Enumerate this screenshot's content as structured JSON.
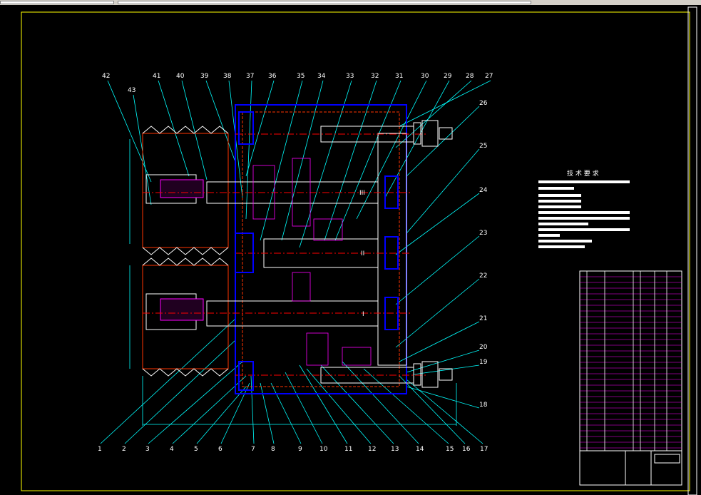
{
  "balloons_top": [
    "42",
    "43",
    "41",
    "40",
    "39",
    "38",
    "37",
    "36",
    "35",
    "34",
    "33",
    "32",
    "31",
    "30",
    "29",
    "28",
    "27"
  ],
  "balloons_right": [
    "26",
    "25",
    "24",
    "23",
    "22",
    "21",
    "20",
    "19",
    "18"
  ],
  "balloons_bottom": [
    "1",
    "2",
    "3",
    "4",
    "5",
    "6",
    "7",
    "8",
    "9",
    "10",
    "11",
    "12",
    "13",
    "14",
    "15",
    "16",
    "17"
  ],
  "shaft_labels": [
    "III",
    "II",
    "I"
  ],
  "tech_req_title": "技 术 要 求",
  "colors": {
    "frame": "#ffff00",
    "part": "#ff3300",
    "hatch": "#ff00ff",
    "center": "#ff0000",
    "leader": "#00ffff",
    "bearing": "#0000ff",
    "text": "#ffffff",
    "title_block": "#ff00ff"
  }
}
